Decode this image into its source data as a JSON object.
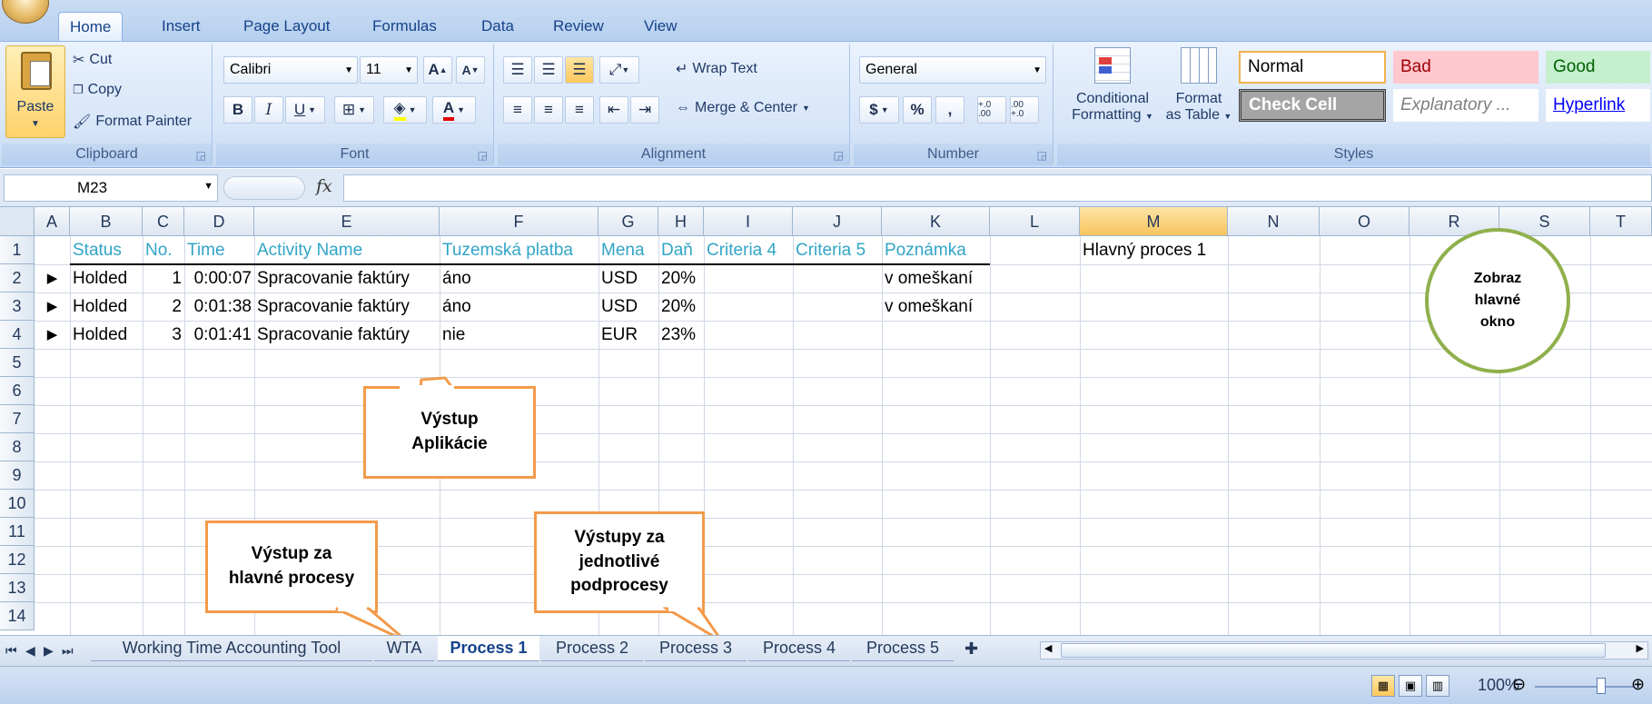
{
  "ribbon_tabs": [
    "Home",
    "Insert",
    "Page Layout",
    "Formulas",
    "Data",
    "Review",
    "View"
  ],
  "clipboard": {
    "paste": "Paste",
    "cut": "Cut",
    "copy": "Copy",
    "format_painter": "Format Painter",
    "label": "Clipboard"
  },
  "font": {
    "name": "Calibri",
    "size": "11",
    "label": "Font",
    "bold": "B",
    "italic": "I",
    "underline": "U",
    "grow": "A",
    "shrink": "A",
    "color": "A"
  },
  "alignment": {
    "wrap_text": "Wrap Text",
    "merge_center": "Merge & Center",
    "label": "Alignment"
  },
  "number": {
    "format": "General",
    "currency": "$",
    "percent": "%",
    "comma": ",",
    "inc_decimal": "+.0 .00",
    "dec_decimal": ".00 +.0",
    "label": "Number"
  },
  "styles": {
    "conditional_formatting": [
      "Conditional",
      "Formatting"
    ],
    "format_as_table": [
      "Format",
      "as Table"
    ],
    "cells": {
      "normal": "Normal",
      "bad": "Bad",
      "good": "Good",
      "check_cell": "Check Cell",
      "explanatory": "Explanatory ...",
      "hyperlink": "Hyperlink"
    },
    "label": "Styles"
  },
  "formula_bar": {
    "name_box": "M23",
    "fx": "fx",
    "content": ""
  },
  "columns": [
    "A",
    "B",
    "C",
    "D",
    "E",
    "F",
    "G",
    "H",
    "I",
    "J",
    "K",
    "L",
    "M",
    "N",
    "O",
    "R",
    "S",
    "T"
  ],
  "rows": [
    "1",
    "2",
    "3",
    "4",
    "5",
    "6",
    "7",
    "8",
    "9",
    "10",
    "11",
    "12",
    "13",
    "14"
  ],
  "table_header": {
    "status": "Status",
    "no": "No.",
    "time": "Time",
    "activity": "Activity Name",
    "tuzemska": "Tuzemská platba",
    "mena": "Mena",
    "dan": "Daň",
    "criteria4": "Criteria 4",
    "criteria5": "Criteria 5",
    "poznamka": "Poznámka",
    "m1": "Hlavný proces 1"
  },
  "table_rows": [
    {
      "marker": "▶",
      "status": "Holded",
      "no": "1",
      "time": "0:00:07",
      "activity": "Spracovanie faktúry",
      "tuzemska": "áno",
      "mena": "USD",
      "dan": "20%",
      "poznamka": "v omeškaní"
    },
    {
      "marker": "▶",
      "status": "Holded",
      "no": "2",
      "time": "0:01:38",
      "activity": "Spracovanie faktúry",
      "tuzemska": "áno",
      "mena": "USD",
      "dan": "20%",
      "poznamka": "v omeškaní"
    },
    {
      "marker": "▶",
      "status": "Holded",
      "no": "3",
      "time": "0:01:41",
      "activity": "Spracovanie faktúry",
      "tuzemska": "nie",
      "mena": "EUR",
      "dan": "23%",
      "poznamka": ""
    }
  ],
  "callouts": {
    "vystup_aplikacie": [
      "Výstup",
      "Aplikácie"
    ],
    "vystup_hlavne": [
      "Výstup za",
      "hlavné procesy"
    ],
    "vystupy_podprocesy": [
      "Výstupy za",
      "jednotlivé",
      "podprocesy"
    ]
  },
  "circle_button": [
    "Zobraz",
    "hlavné",
    "okno"
  ],
  "sheet_tabs": [
    "Working Time Accounting Tool",
    "WTA",
    "Process 1",
    "Process 2",
    "Process 3",
    "Process 4",
    "Process 5"
  ],
  "active_sheet": "Process 1",
  "zoom": "100%",
  "colors": {
    "header_text": "#31a5c7",
    "callout_border": "#f39a4a",
    "circle_border": "#8fb04c",
    "ribbon_text": "#15428b"
  }
}
